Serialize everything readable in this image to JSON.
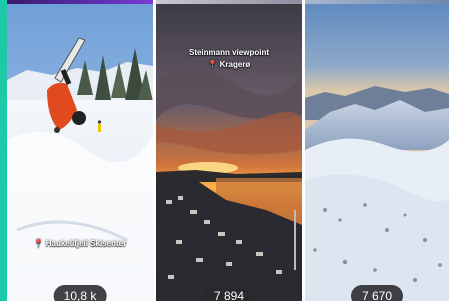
{
  "accent_color": "#1ec9a8",
  "tiles": [
    {
      "scene": "snowboarder doing a trick in deep snow",
      "location_icon": "location-pin-icon",
      "location": "Haukelifjell Skisenter",
      "title": "",
      "views": "10,8 k"
    },
    {
      "scene": "sunset over a coastal town",
      "location_icon": "location-pin-icon",
      "title": "Steinmann viewpoint",
      "location": "Kragerø",
      "views": "7 894"
    },
    {
      "scene": "snowy mountain landscape at dusk",
      "location_icon": "",
      "title": "",
      "location": "",
      "views": "7 670"
    }
  ]
}
